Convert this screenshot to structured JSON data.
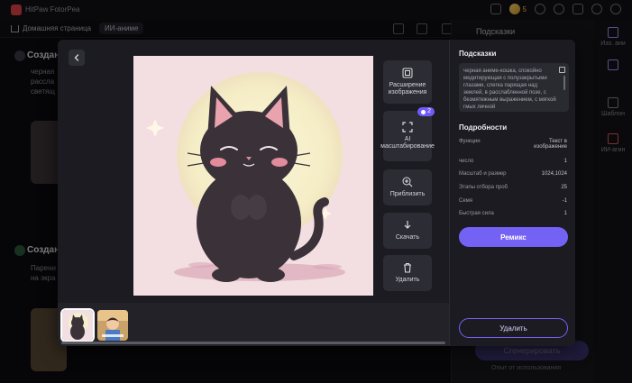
{
  "app": {
    "title": "HitPaw FotorPea",
    "coin_count": "5"
  },
  "nav": {
    "home": "Домашняя страница",
    "ai_tab": "ИИ-аниме"
  },
  "background": {
    "section1_title": "Создан",
    "section1_text": [
      "черная",
      "рассла",
      "светящ"
    ],
    "section2_title": "Создан",
    "section2_text": [
      "Парени",
      "на экра"
    ],
    "right_panel_title": "Подсказки",
    "rail": [
      {
        "icon": "image-icon",
        "label": "Изо. ани"
      },
      {
        "icon": "layout-icon",
        "label": ""
      },
      {
        "icon": "template-icon",
        "label": "Шаблон"
      },
      {
        "icon": "ai-aging-icon",
        "label": "ИИ-агин"
      }
    ],
    "generate_label": "Сгенерировать",
    "footnote": "Опыт от использования"
  },
  "modal": {
    "tools": [
      {
        "icon": "expand-image-icon",
        "label": "Расширение изображения",
        "badge": ""
      },
      {
        "icon": "upscale-icon",
        "label": "AI масштабирование",
        "badge": "2"
      },
      {
        "icon": "zoom-in-icon",
        "label": "Приблизить",
        "badge": ""
      },
      {
        "icon": "download-icon",
        "label": "Скачать",
        "badge": ""
      },
      {
        "icon": "trash-icon",
        "label": "Удалить",
        "badge": ""
      }
    ],
    "details": {
      "prompt_title": "Подсказки",
      "prompt_text": "черная аниме-кошка, спокойно медитирующая с полузакрытыми глазами, слегка парящая над землей, в расслабленной позе, с безмятежным выражением, с мягкой гмых личной",
      "details_title": "Подробности",
      "rows": [
        {
          "label": "Функции",
          "value": "Текст в изображение"
        },
        {
          "label": "число",
          "value": "1"
        },
        {
          "label": "Масштаб и размер",
          "value": "1024,1024"
        },
        {
          "label": "Этапы отбора проб",
          "value": "25"
        },
        {
          "label": "Семя",
          "value": "-1"
        },
        {
          "label": "Быстрая сила",
          "value": "1"
        }
      ],
      "remix_label": "Ремикс",
      "delete_label": "Удалить"
    }
  }
}
